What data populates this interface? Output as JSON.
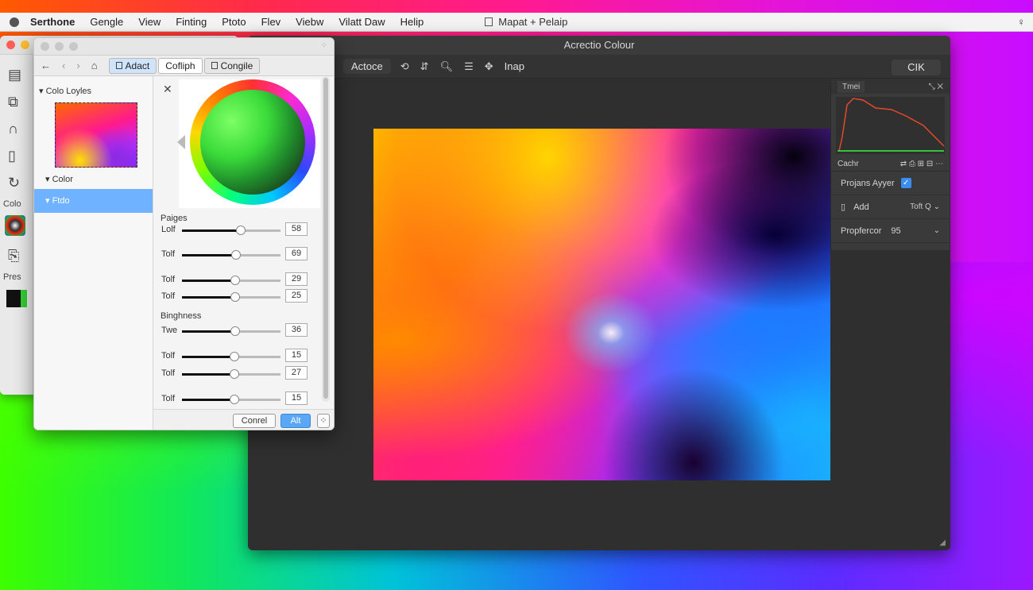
{
  "menubar": {
    "items": [
      "Serthone",
      "Gengle",
      "View",
      "Finting",
      "Ptoto",
      "Flev",
      "Viebw",
      "Vilatt Daw",
      "Helip"
    ],
    "document": "Mapat + Pelaip"
  },
  "main_window": {
    "title": "Acrectio Colour",
    "toolbar": {
      "active_label": "Actoce",
      "map_label": "Inap",
      "ok_label": "CIK"
    },
    "panel": {
      "tab_label": "Tmei",
      "histogram_icons": "Cachr",
      "project_layer_label": "Projans Ayyer",
      "project_layer_checked": true,
      "add_label": "Add",
      "add_right": "Toft Q",
      "prop_label": "Propfercor",
      "prop_value": "95"
    }
  },
  "back_window": {
    "labels": [
      "Colo",
      "Pres"
    ]
  },
  "dialog": {
    "tabs": [
      {
        "label": "Adact"
      },
      {
        "label": "Cofliph"
      },
      {
        "label": "Congile"
      }
    ],
    "layers_header": "Colo Loyles",
    "color_header": "Color",
    "selected_item": "Ftdo",
    "ranges_header": "Paiges",
    "brightness_header": "Binghness",
    "sliders": [
      {
        "label": "Lolf",
        "value": "58",
        "fraction": 0.6
      },
      {
        "label": "Tolf",
        "value": "69",
        "fraction": 0.55
      },
      {
        "label": "Tolf",
        "value": "29",
        "fraction": 0.54
      },
      {
        "label": "Tolf",
        "value": "25",
        "fraction": 0.54
      },
      {
        "label": "Twe",
        "value": "36",
        "fraction": 0.54
      },
      {
        "label": "Tolf",
        "value": "15",
        "fraction": 0.53
      },
      {
        "label": "Tolf",
        "value": "27",
        "fraction": 0.53
      },
      {
        "label": "Tolf",
        "value": "15",
        "fraction": 0.53
      }
    ],
    "cancel_label": "Conrel",
    "apply_label": "Alt"
  }
}
